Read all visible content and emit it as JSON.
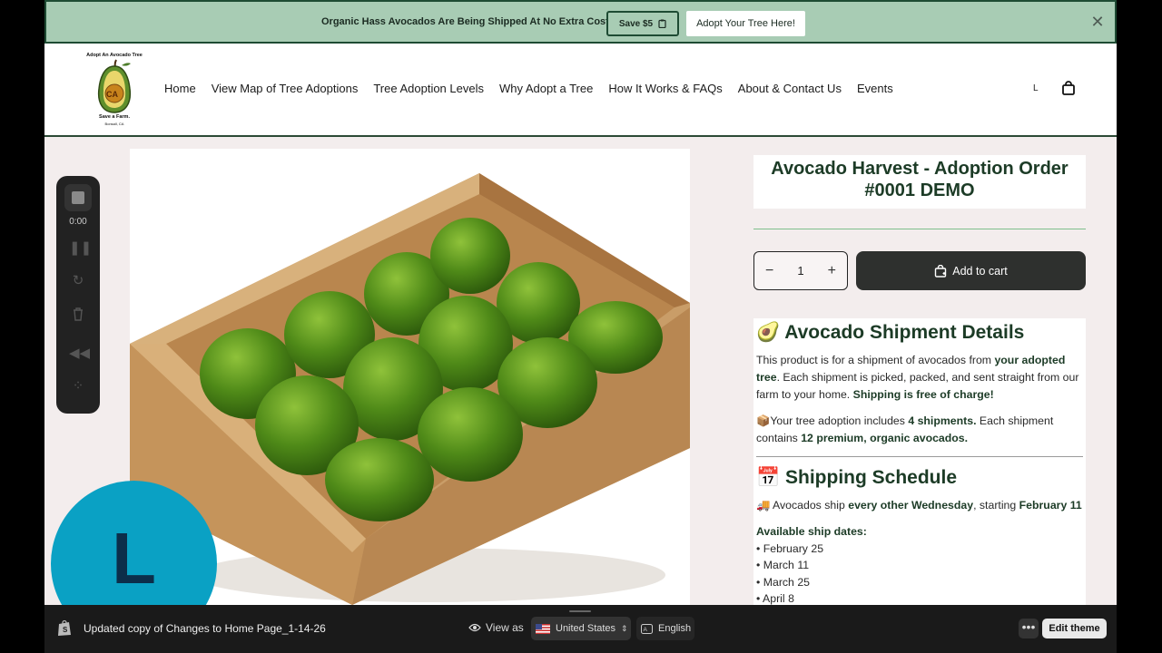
{
  "announcement": {
    "message": "Organic Hass Avocados Are Being Shipped At No Extra Cost.",
    "save_label": "Save $5",
    "adopt_label": "Adopt Your Tree Here!"
  },
  "logo": {
    "top_text": "Adopt An Avocado Tree",
    "badge": "CA",
    "bottom_text": "Save a Farm.",
    "small_text": "Bonsall, CA"
  },
  "nav": [
    "Home",
    "View Map of Tree Adoptions",
    "Tree Adoption Levels",
    "Why Adopt a Tree",
    "How It Works & FAQs",
    "About & Contact Us",
    "Events"
  ],
  "header": {
    "account_initial": "L"
  },
  "recorder": {
    "time": "0:00"
  },
  "avatar": {
    "initial": "L"
  },
  "product": {
    "title": "Avocado Harvest - Adoption Order #0001 DEMO",
    "quantity": "1",
    "add_to_cart": "Add to cart"
  },
  "details": {
    "heading_emoji": "🥑",
    "heading": "Avocado Shipment Details",
    "p1_a": "This product is for a shipment of avocados from ",
    "p1_b": "your adopted tree",
    "p1_c": ".  Each shipment is picked, packed, and sent straight from our farm to your home.  ",
    "p1_d": "Shipping is free of charge!",
    "p2_emoji": "📦",
    "p2_a": "Your tree adoption includes ",
    "p2_b": "4 shipments.",
    "p2_c": "  Each shipment contains ",
    "p2_d": "12 premium, organic avocados.",
    "schedule_emoji": "📅",
    "schedule_heading": "Shipping Schedule",
    "p3_emoji": "🚚",
    "p3_a": " Avocados ship ",
    "p3_b": "every other Wednesday",
    "p3_c": ", starting ",
    "p3_d": "February 11",
    "dates_label": "Available ship dates:",
    "dates": [
      "February 25",
      "March 11",
      "March 25",
      "April 8"
    ]
  },
  "bottombar": {
    "theme_name": "Updated copy of Changes to Home Page_1-14-26",
    "view_as": "View as",
    "country": "United States",
    "language": "English",
    "more": "•••",
    "edit_theme": "Edit theme"
  }
}
